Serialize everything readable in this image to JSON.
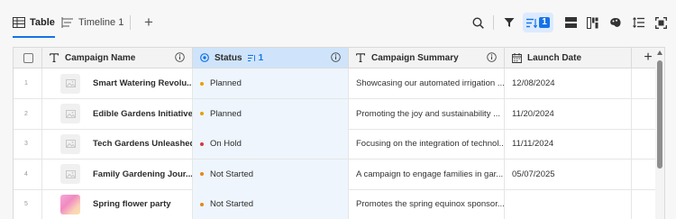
{
  "toolbar": {
    "tabs": [
      {
        "label": "Table",
        "icon": "table-icon",
        "active": true
      },
      {
        "label": "Timeline 1",
        "icon": "timeline-icon",
        "active": false
      }
    ],
    "add_view_label": "+",
    "sort_count": "1",
    "tools": [
      "search-icon",
      "filter-icon",
      "sort-icon",
      "row-height-icon",
      "card-layout-icon",
      "color-icon",
      "line-spacing-icon",
      "fullscreen-icon"
    ]
  },
  "table": {
    "columns": [
      {
        "label": "Campaign Name",
        "type": "text"
      },
      {
        "label": "Status",
        "type": "status",
        "sort_count": "1"
      },
      {
        "label": "Campaign Summary",
        "type": "text"
      },
      {
        "label": "Launch Date",
        "type": "date"
      }
    ],
    "add_column_label": "+",
    "rows": [
      {
        "num": "1",
        "name": "Smart Watering Revolu...",
        "status": "Planned",
        "status_color": "#e6a000",
        "summary": "Showcasing our automated irrigation ...",
        "date": "12/08/2024",
        "thumb": "placeholder"
      },
      {
        "num": "2",
        "name": "Edible Gardens Initiative",
        "status": "Planned",
        "status_color": "#e6a000",
        "summary": "Promoting the joy and sustainability ...",
        "date": "11/20/2024",
        "thumb": "placeholder"
      },
      {
        "num": "3",
        "name": "Tech Gardens Unleashed",
        "status": "On Hold",
        "status_color": "#d7373f",
        "summary": "Focusing on the integration of technol...",
        "date": "11/11/2024",
        "thumb": "placeholder"
      },
      {
        "num": "4",
        "name": "Family Gardening Jour...",
        "status": "Not Started",
        "status_color": "#e68619",
        "summary": "A campaign to engage families in gar...",
        "date": "05/07/2025",
        "thumb": "placeholder"
      },
      {
        "num": "5",
        "name": "Spring flower party",
        "status": "Not Started",
        "status_color": "#e68619",
        "summary": "Promotes the spring equinox sponsor...",
        "date": "",
        "thumb": "flower"
      }
    ]
  },
  "colors": {
    "accent": "#1473e6",
    "status_header": "#cfe4fb",
    "status_cell": "#eef5fd"
  }
}
